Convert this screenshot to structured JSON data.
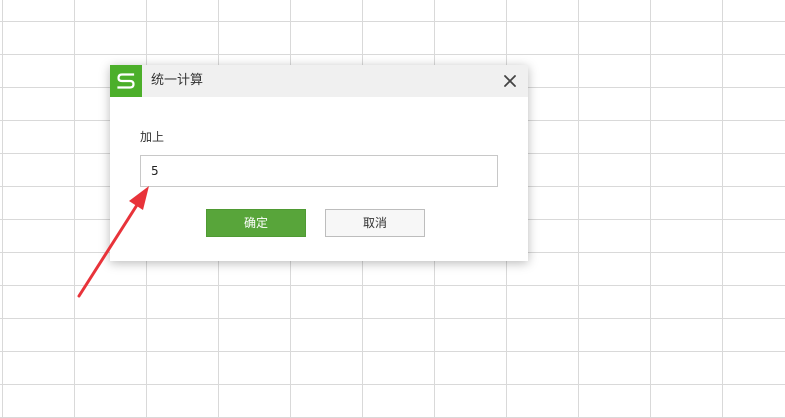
{
  "dialog": {
    "title": "统一计算",
    "field_label": "加上",
    "input_value": "5",
    "ok_label": "确定",
    "cancel_label": "取消"
  },
  "icons": {
    "app_logo": "wps-spreadsheet-s-logo",
    "close": "close-x-icon",
    "annotation": "red-arrow-pointing-to-input"
  },
  "colors": {
    "brand_green": "#4caf2a",
    "ok_button": "#58a53a",
    "annotation_red": "#e8333a",
    "grid_line": "#d9d9d9"
  }
}
